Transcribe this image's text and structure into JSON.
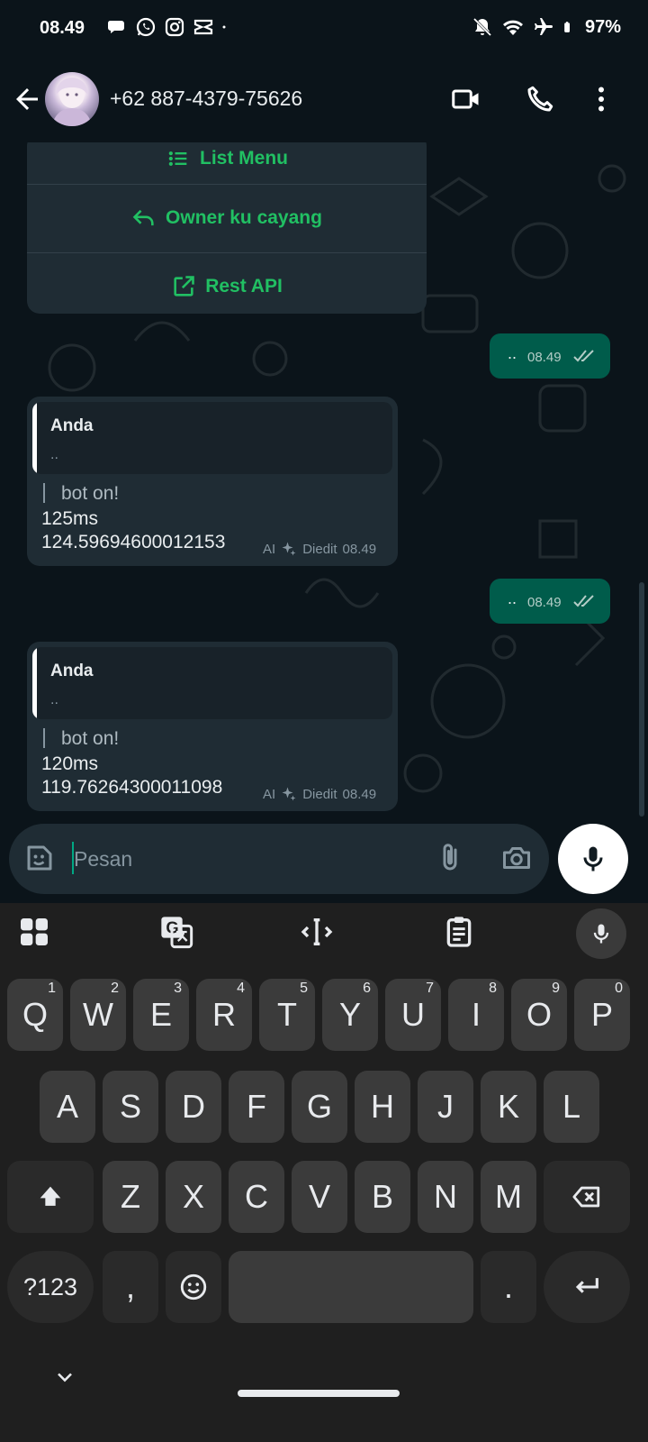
{
  "status_bar": {
    "time": "08.49",
    "battery": "97%",
    "left_icons": [
      "chat-notification-icon",
      "whatsapp-icon",
      "instagram-icon",
      "capcut-icon",
      "dot-icon"
    ],
    "right_icons": [
      "bell-muted-icon",
      "wifi-icon",
      "airplane-icon",
      "battery-icon"
    ]
  },
  "header": {
    "contact_name": "+62 887-4379-75626",
    "icons": [
      "back-arrow-icon",
      "avatar",
      "video-call-icon",
      "phone-call-icon",
      "more-vert-icon"
    ]
  },
  "chat": {
    "menu_items": [
      {
        "label": "List Menu",
        "icon": "list-icon"
      },
      {
        "label": "Owner ku cayang",
        "icon": "reply-icon"
      },
      {
        "label": "Rest API",
        "icon": "external-link-icon"
      }
    ],
    "messages": [
      {
        "direction": "out",
        "text": "..",
        "time": "08.49"
      },
      {
        "direction": "in",
        "quote_author": "Anda",
        "quote_text": "..",
        "line1": "bot on!",
        "line2": "125ms",
        "line3": "124.59694600012153",
        "ai_label": "AI",
        "edited_label": "Diedit",
        "time": "08.49"
      },
      {
        "direction": "out",
        "text": "..",
        "time": "08.49"
      },
      {
        "direction": "in",
        "quote_author": "Anda",
        "quote_text": "..",
        "line1": "bot on!",
        "line2": "120ms",
        "line3": "119.76264300011098",
        "ai_label": "AI",
        "edited_label": "Diedit",
        "time": "08.49"
      }
    ]
  },
  "composer": {
    "placeholder": "Pesan",
    "value": ""
  },
  "keyboard": {
    "row1": [
      {
        "key": "Q",
        "num": "1"
      },
      {
        "key": "W",
        "num": "2"
      },
      {
        "key": "E",
        "num": "3"
      },
      {
        "key": "R",
        "num": "4"
      },
      {
        "key": "T",
        "num": "5"
      },
      {
        "key": "Y",
        "num": "6"
      },
      {
        "key": "U",
        "num": "7"
      },
      {
        "key": "I",
        "num": "8"
      },
      {
        "key": "O",
        "num": "9"
      },
      {
        "key": "P",
        "num": "0"
      }
    ],
    "row2": [
      "A",
      "S",
      "D",
      "F",
      "G",
      "H",
      "J",
      "K",
      "L"
    ],
    "row3": [
      "Z",
      "X",
      "C",
      "V",
      "B",
      "N",
      "M"
    ],
    "symbols_label": "?123",
    "comma": ",",
    "period": "."
  },
  "colors": {
    "background": "#0b141a",
    "bubble_in": "#1f2c34",
    "bubble_out": "#005c4b",
    "accent_green": "#21c063",
    "keyboard_bg": "#1f1f1f",
    "key_bg": "#3b3b3b"
  }
}
